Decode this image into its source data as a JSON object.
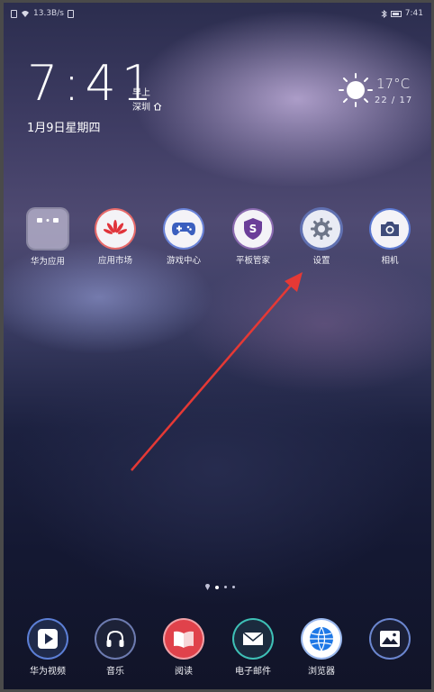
{
  "status": {
    "speed": "13.3B/s",
    "time": "7:41"
  },
  "clock": {
    "time": "7:41",
    "ampm": "早上",
    "city": "深圳",
    "date": "1月9日星期四"
  },
  "weather": {
    "temp": "17°C",
    "range": "22 / 17"
  },
  "apps_row": [
    {
      "label": "华为应用",
      "icon": "folder-icon"
    },
    {
      "label": "应用市场",
      "icon": "huawei-appgallery-icon"
    },
    {
      "label": "游戏中心",
      "icon": "gamepad-icon"
    },
    {
      "label": "平板管家",
      "icon": "shield-icon"
    },
    {
      "label": "设置",
      "icon": "gear-icon"
    },
    {
      "label": "相机",
      "icon": "camera-icon"
    }
  ],
  "dock": [
    {
      "label": "华为视频",
      "icon": "play-icon"
    },
    {
      "label": "音乐",
      "icon": "headphones-icon"
    },
    {
      "label": "阅读",
      "icon": "book-icon"
    },
    {
      "label": "电子邮件",
      "icon": "mail-icon"
    },
    {
      "label": "浏览器",
      "icon": "globe-icon"
    },
    {
      "label": "",
      "icon": "gallery-icon"
    }
  ],
  "colors": {
    "arrow": "#e53935",
    "accent_blue": "#3b5fbf",
    "reader_red": "#e0424b"
  }
}
